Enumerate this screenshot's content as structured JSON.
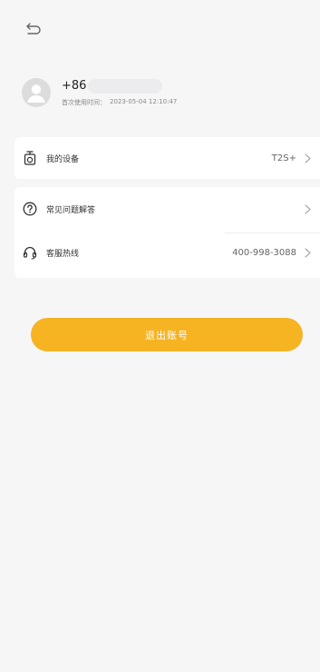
{
  "header": {
    "back_icon": "back-arrow-icon"
  },
  "profile": {
    "phone_prefix": "+86",
    "first_use_label": "首次使用时间：",
    "first_use_time": "2023-05-04 12:10:47"
  },
  "menu": {
    "device": {
      "icon": "device-icon",
      "label": "我的设备",
      "value": "T2S+"
    },
    "faq": {
      "icon": "question-icon",
      "label": "常见问题解答"
    },
    "hotline": {
      "icon": "headset-icon",
      "label": "客服热线",
      "value": "400-998-3088"
    }
  },
  "logout_button": {
    "label": "退出账号"
  },
  "colors": {
    "accent": "#f6b322",
    "background": "#f6f6f7"
  }
}
